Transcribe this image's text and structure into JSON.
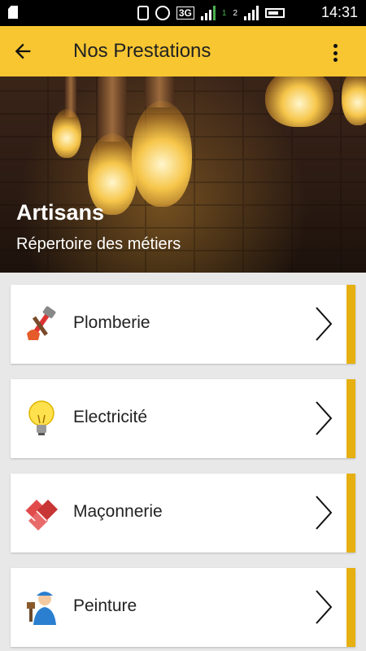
{
  "status_bar": {
    "time": "14:31",
    "network": "3G",
    "sim1": "1",
    "sim2": "2"
  },
  "app_bar": {
    "title": "Nos Prestations"
  },
  "hero": {
    "title": "Artisans",
    "subtitle": "Répertoire des métiers"
  },
  "services": [
    {
      "label": "Plomberie",
      "icon": "plumbing-tools-icon"
    },
    {
      "label": "Electricité",
      "icon": "light-bulb-icon"
    },
    {
      "label": "Maçonnerie",
      "icon": "bricks-icon"
    },
    {
      "label": "Peinture",
      "icon": "painter-icon"
    }
  ],
  "colors": {
    "app_bar": "#f7c631",
    "accent": "#e6b012",
    "background": "#e8e8e8"
  }
}
